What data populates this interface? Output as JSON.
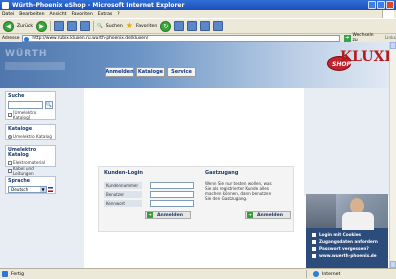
{
  "window": {
    "title": "Würth-Phoenix eShop - Microsoft Internet Explorer"
  },
  "menu": [
    "Datei",
    "Bearbeiten",
    "Ansicht",
    "Favoriten",
    "Extras",
    "?"
  ],
  "toolbar": {
    "back": "Zurück",
    "search": "Suchen",
    "favorites": "Favoriten"
  },
  "address": {
    "label": "Adresse",
    "url": "http://www.rubix.kluxen.ru.wurth-phoenix.de/kluxen/",
    "go": "Wechseln zu",
    "links": "Links"
  },
  "nav": {
    "tabs": [
      "Anmelden",
      "Kataloge",
      "Service"
    ]
  },
  "logo": {
    "word": "KLUXEN",
    "shop": "SHOP"
  },
  "sidebar": {
    "search": {
      "title": "Suche",
      "option": "[Umelektro Katalog]"
    },
    "catalog": {
      "title": "Kataloge",
      "option": "Umelektro Katalog"
    },
    "umelektro": {
      "title": "Umelektro Katalog",
      "items": [
        "Elektromaterial",
        "Kabel und Leitungen"
      ]
    },
    "language": {
      "title": "Sprache",
      "value": "Deutsch"
    }
  },
  "login": {
    "title": "Kunden-Login",
    "fields": [
      "Kundennummer",
      "Benutzer",
      "Kennwort"
    ],
    "submit": "Anmelden"
  },
  "guest": {
    "title": "Gastzugang",
    "text": "Wenn Sie nur testen wollen, was Sie als registrierter Kunde alles machen können, dann benutzen Sie den Gastzugang.",
    "submit": "Anmelden"
  },
  "promo": {
    "links": [
      "Login mit Cookies",
      "Zugangsdaten anfordern",
      "Passwort vergessen?",
      "www.wuerth-phoenix.de"
    ]
  },
  "status": {
    "left": "Fertig",
    "zone": "Internet"
  },
  "colors": {
    "header": "#4f77ad",
    "accent": "#b51a1a",
    "sidebar": "#e8edf3"
  }
}
